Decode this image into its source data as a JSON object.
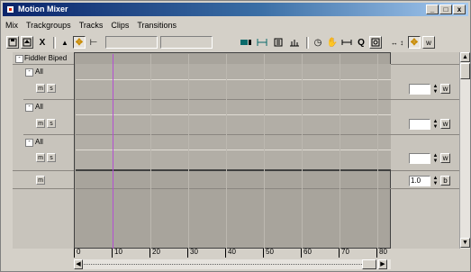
{
  "window": {
    "title": "Motion Mixer",
    "minimize": "_",
    "maximize": "□",
    "close": "x"
  },
  "menu": [
    "Mix",
    "Trackgroups",
    "Tracks",
    "Clips",
    "Transitions"
  ],
  "toolbar": {
    "icons": [
      "save-icon",
      "upload-icon",
      "delete-icon",
      "select-arrow-icon",
      "move-icon",
      "trim-icon",
      "track-view-icon",
      "fit-icon",
      "clip-icon",
      "graph-icon",
      "time-icon",
      "pan-icon",
      "zoom-extents-icon",
      "zoom-icon",
      "zoom-region-icon",
      "scale-icon",
      "snap-icon",
      "w-icon"
    ],
    "glyphs": {
      "delete": "X",
      "select": "▲",
      "move": "✥",
      "trim": "⊢",
      "time": "◷",
      "pan": "✋",
      "zoom": "Q",
      "scale": "↔ ↕",
      "w": "w"
    }
  },
  "tracks": {
    "root_label": "Fiddler Biped",
    "groups": [
      {
        "label": "All",
        "m": "m",
        "s": "s",
        "w": "w"
      },
      {
        "label": "All",
        "m": "m",
        "s": "s",
        "w": "w"
      },
      {
        "label": "All",
        "m": "m",
        "s": "s",
        "w": "w"
      }
    ],
    "mix_row": {
      "m": "m",
      "weight": "1.0",
      "b": "b"
    }
  },
  "ruler": {
    "ticks": [
      "0",
      "10",
      "20",
      "30",
      "40",
      "50",
      "60",
      "70",
      "80"
    ]
  },
  "playhead_frame": 10,
  "colors": {
    "titlebar_start": "#0a246a",
    "titlebar_end": "#a6caf0",
    "playhead": "#b450d2",
    "track_bg": "#a8a49c",
    "move_tool_active": "#f5c400"
  }
}
